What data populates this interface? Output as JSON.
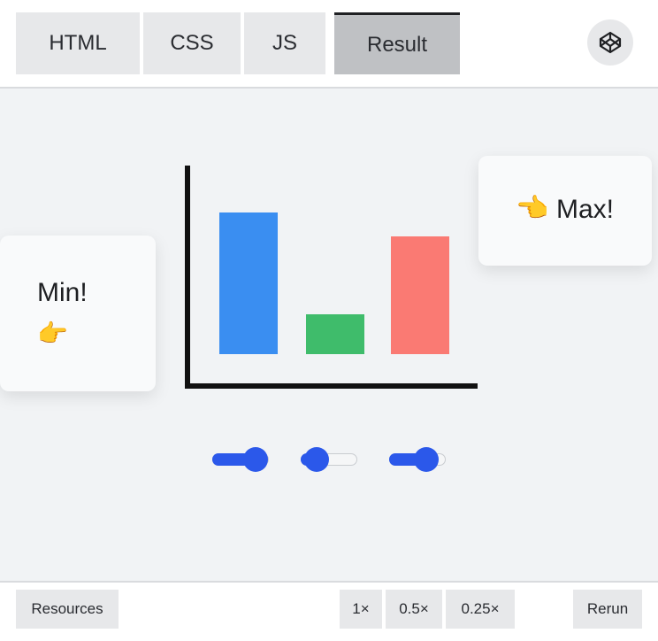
{
  "tabs": {
    "html": "HTML",
    "css": "CSS",
    "js": "JS",
    "result": "Result"
  },
  "header": {
    "codepen_icon": "codepen-icon"
  },
  "cards": {
    "min": {
      "label": "Min!",
      "emoji": "👉"
    },
    "max": {
      "label": "Max!",
      "emoji": "👈"
    }
  },
  "chart_data": {
    "type": "bar",
    "categories": [
      "",
      "",
      ""
    ],
    "values": [
      160,
      45,
      133
    ],
    "ylim": [
      0,
      210
    ],
    "colors": [
      "#3a8ef1",
      "#3fbc6b",
      "#fa7a73"
    ],
    "axis_color": "#111111",
    "grid": false
  },
  "sliders": [
    {
      "value": 0.76
    },
    {
      "value": 0.28
    },
    {
      "value": 0.66
    }
  ],
  "accent_color": "#2b58ea",
  "footer": {
    "resources": "Resources",
    "speed_1": "1×",
    "speed_05": "0.5×",
    "speed_025": "0.25×",
    "rerun": "Rerun"
  }
}
